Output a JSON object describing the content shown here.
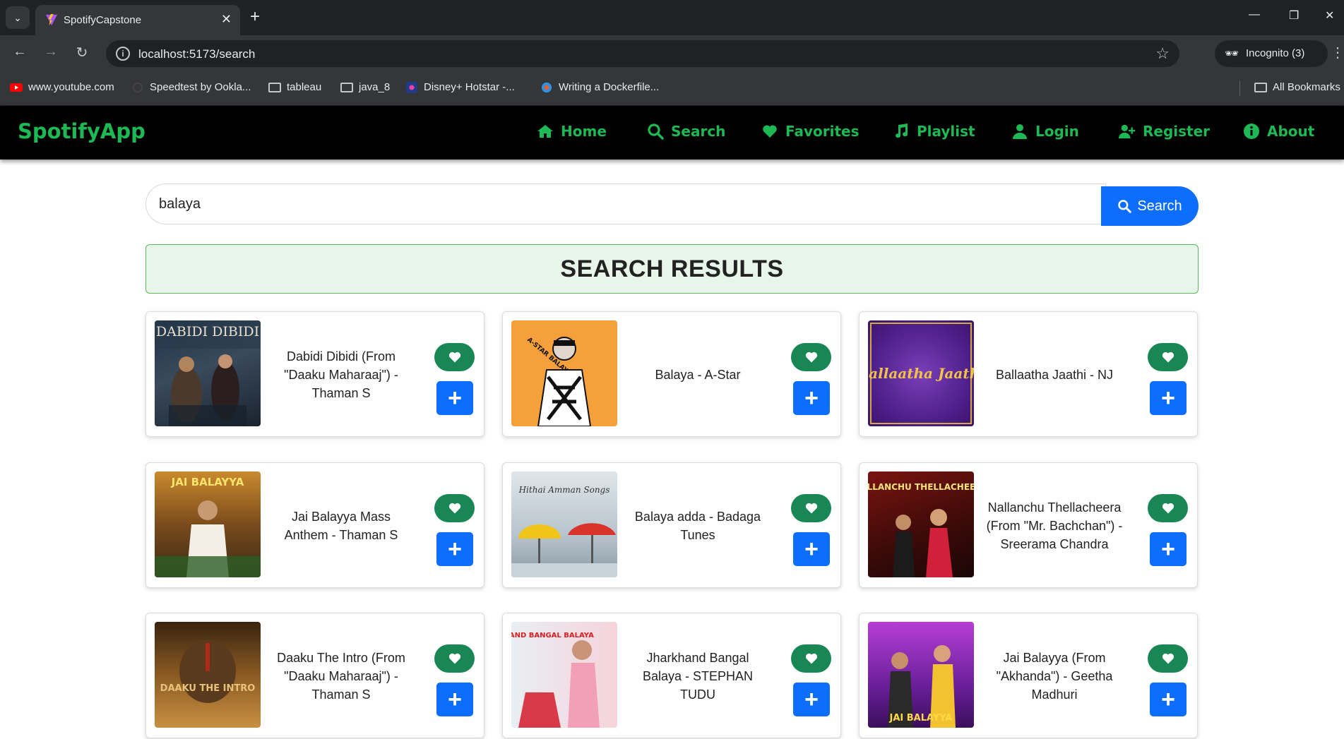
{
  "browser": {
    "tab_title": "SpotifyCapstone",
    "url": "localhost:5173/search",
    "incognito_label": "Incognito (3)",
    "bookmarks": [
      {
        "label": "www.youtube.com",
        "icon": "youtube-icon"
      },
      {
        "label": "Speedtest by Ookla...",
        "icon": "speedtest-icon"
      },
      {
        "label": "tableau",
        "icon": "folder-icon"
      },
      {
        "label": "java_8",
        "icon": "folder-icon"
      },
      {
        "label": "Disney+ Hotstar -...",
        "icon": "hotstar-icon"
      },
      {
        "label": "Writing a Dockerfile...",
        "icon": "docker-icon"
      }
    ],
    "all_bookmarks": "All Bookmarks"
  },
  "app": {
    "brand": "SpotifyApp",
    "nav": [
      {
        "label": "Home",
        "icon": "home-icon"
      },
      {
        "label": "Search",
        "icon": "search-icon"
      },
      {
        "label": "Favorites",
        "icon": "heart-icon"
      },
      {
        "label": "Playlist",
        "icon": "music-icon"
      },
      {
        "label": "Login",
        "icon": "user-icon"
      },
      {
        "label": "Register",
        "icon": "user-plus-icon"
      },
      {
        "label": "About",
        "icon": "info-icon"
      }
    ],
    "colors": {
      "brand": "#1db954",
      "primary": "#0d6efd",
      "favorite": "#198754"
    }
  },
  "search": {
    "value": "balaya",
    "button_label": "Search"
  },
  "results": {
    "heading": "SEARCH RESULTS",
    "songs": [
      {
        "title": "Dabidi Dibidi (From \"Daaku Maharaaj\") - Thaman S",
        "art_text": "DABIDI DIBIDI"
      },
      {
        "title": "Balaya - A-Star",
        "art_text": "A-STAR BALAYA"
      },
      {
        "title": "Ballaatha Jaathi - NJ",
        "art_text": "Ballaatha Jaathi"
      },
      {
        "title": "Jai Balayya Mass Anthem - Thaman S",
        "art_text": "JAI BALAYYA"
      },
      {
        "title": "Balaya adda - Badaga Tunes",
        "art_text": "Hithai Amman Songs"
      },
      {
        "title": "Nallanchu Thellacheera (From \"Mr. Bachchan\") - Sreerama Chandra",
        "art_text": "NALLANCHU THELLACHEERA"
      },
      {
        "title": "Daaku The Intro (From \"Daaku Maharaaj\") - Thaman S",
        "art_text": "DAAKU THE INTRO"
      },
      {
        "title": "Jharkhand Bangal Balaya - STEPHAN TUDU",
        "art_text": "JHARKHAND BANGAL BALAYA"
      },
      {
        "title": "Jai Balayya (From \"Akhanda\") - Geetha Madhuri",
        "art_text": "JAI BALAYYA"
      }
    ]
  }
}
